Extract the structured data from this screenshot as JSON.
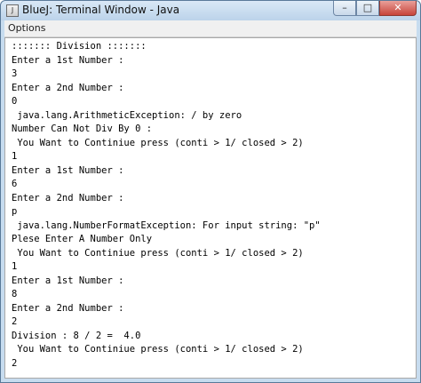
{
  "window": {
    "title": "BlueJ: Terminal Window - Java",
    "controls": {
      "minimize": "–",
      "maximize": "□",
      "close": "✕"
    }
  },
  "menu": {
    "options_label": "Options"
  },
  "terminal": {
    "lines": [
      "::::::: Division :::::::",
      "Enter a 1st Number :",
      "3",
      "Enter a 2nd Number :",
      "0",
      " java.lang.ArithmeticException: / by zero",
      "Number Can Not Div By 0 :",
      " You Want to Continiue press (conti > 1/ closed > 2)",
      "1",
      "Enter a 1st Number :",
      "6",
      "Enter a 2nd Number :",
      "p",
      " java.lang.NumberFormatException: For input string: \"p\"",
      "Plese Enter A Number Only",
      " You Want to Continiue press (conti > 1/ closed > 2)",
      "1",
      "Enter a 1st Number :",
      "8",
      "Enter a 2nd Number :",
      "2",
      "Division : 8 / 2 =  4.0",
      " You Want to Continiue press (conti > 1/ closed > 2)",
      "2"
    ]
  }
}
